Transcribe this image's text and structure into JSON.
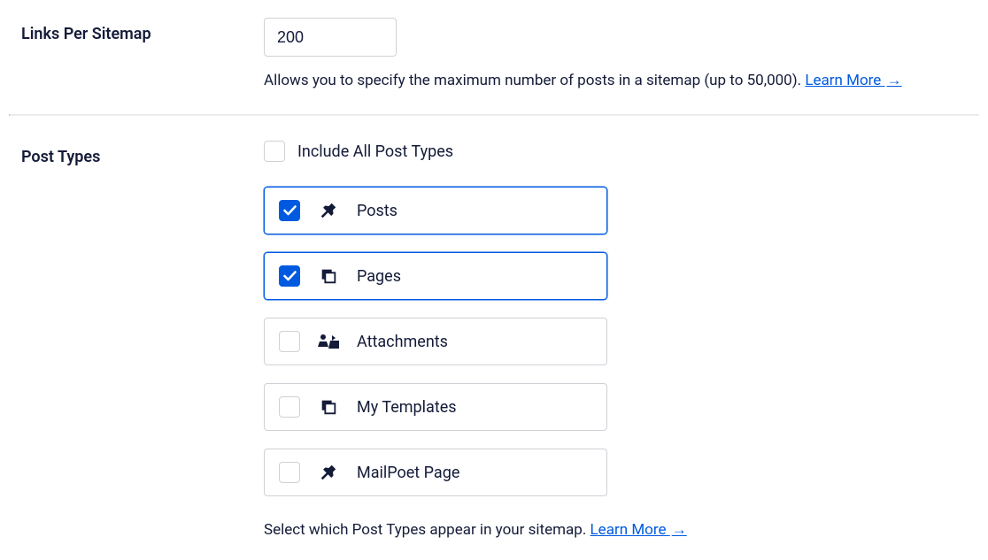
{
  "links_per_sitemap": {
    "label": "Links Per Sitemap",
    "value": "200",
    "help": "Allows you to specify the maximum number of posts in a sitemap (up to 50,000).",
    "learn_more": "Learn More"
  },
  "post_types": {
    "label": "Post Types",
    "include_all_label": "Include All Post Types",
    "include_all_checked": false,
    "items": [
      {
        "label": "Posts",
        "checked": true,
        "icon": "pin"
      },
      {
        "label": "Pages",
        "checked": true,
        "icon": "stack"
      },
      {
        "label": "Attachments",
        "checked": false,
        "icon": "media"
      },
      {
        "label": "My Templates",
        "checked": false,
        "icon": "stack"
      },
      {
        "label": "MailPoet Page",
        "checked": false,
        "icon": "pin"
      }
    ],
    "help": "Select which Post Types appear in your sitemap.",
    "learn_more": "Learn More"
  }
}
